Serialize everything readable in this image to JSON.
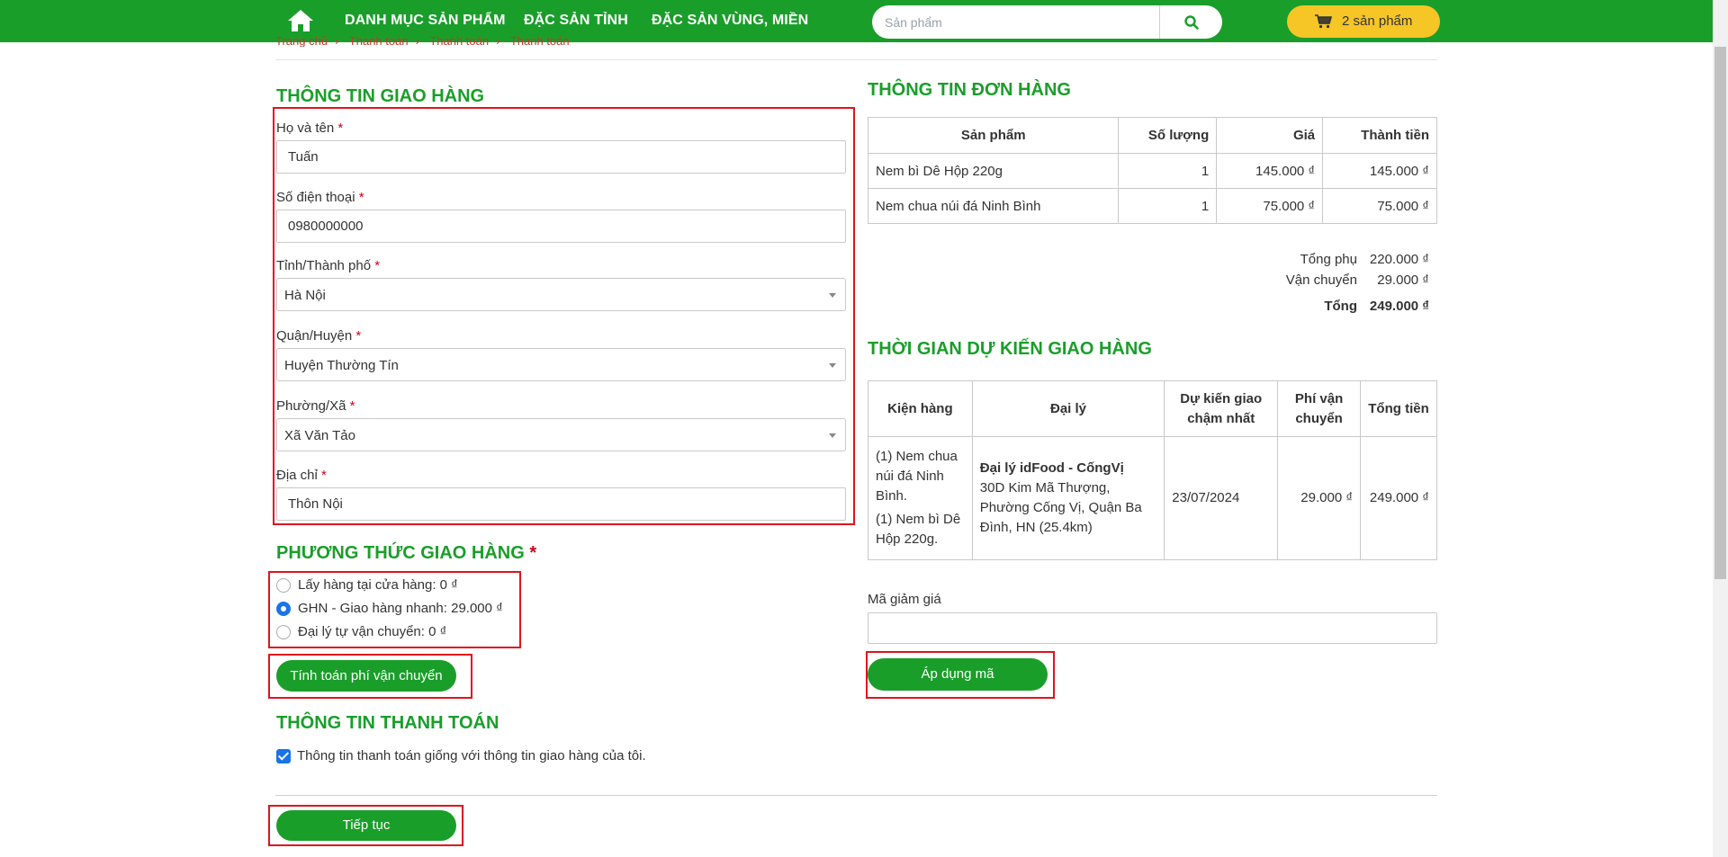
{
  "nav": {
    "links": [
      "DANH MỤC SẢN PHẨM",
      "ĐẶC SẢN TỈNH",
      "ĐẶC SẢN VÙNG, MIỀN"
    ],
    "search_placeholder": "Sản phẩm",
    "cart_label": "2 sản phẩm"
  },
  "breadcrumb": [
    "Trang chủ",
    "Thanh toán",
    "Thanh toán",
    "Thanh toán"
  ],
  "shipping_info": {
    "title": "THÔNG TIN GIAO HÀNG",
    "required_mark": "*",
    "fields": {
      "name": {
        "label": "Họ và tên",
        "value": "Tuấn"
      },
      "phone": {
        "label": "Số điện thoại",
        "value": "0980000000"
      },
      "province": {
        "label": "Tỉnh/Thành phố",
        "value": "Hà Nội"
      },
      "district": {
        "label": "Quận/Huyện",
        "value": "Huyện Thường Tín"
      },
      "ward": {
        "label": "Phường/Xã",
        "value": "Xã Văn Tảo"
      },
      "address": {
        "label": "Địa chỉ",
        "value": "Thôn Nội"
      }
    }
  },
  "shipping_method": {
    "title": "PHƯƠNG THỨC GIAO HÀNG",
    "options": [
      {
        "label": "Lấy hàng tại cửa hàng: 0 ₫",
        "checked": false
      },
      {
        "label": "GHN - Giao hàng nhanh: 29.000 ₫",
        "checked": true
      },
      {
        "label": "Đại lý tự vận chuyển: 0 ₫",
        "checked": false
      }
    ],
    "calc_button": "Tính toán phí vận chuyển"
  },
  "payment_info": {
    "title": "THÔNG TIN THANH TOÁN",
    "same_as_shipping_label": "Thông tin thanh toán giống với thông tin giao hàng của tôi.",
    "same_as_shipping_checked": true
  },
  "continue_button": "Tiếp tục",
  "order_info": {
    "title": "THÔNG TIN ĐƠN HÀNG",
    "headers": [
      "Sản phẩm",
      "Số lượng",
      "Giá",
      "Thành tiền"
    ],
    "rows": [
      [
        "Nem bì Dê Hộp 220g",
        "1",
        "145.000 ₫",
        "145.000 ₫"
      ],
      [
        "Nem chua núi đá Ninh Bình",
        "1",
        "75.000 ₫",
        "75.000 ₫"
      ]
    ],
    "subtotal_label": "Tổng phụ",
    "subtotal_value": "220.000 ₫",
    "shipping_label": "Vận chuyển",
    "shipping_value": "29.000 ₫",
    "total_label": "Tổng",
    "total_value": "249.000 ₫"
  },
  "delivery_time": {
    "title": "THỜI GIAN DỰ KIẾN GIAO HÀNG",
    "headers": [
      "Kiện hàng",
      "Đại lý",
      "Dự kiến giao chậm nhất",
      "Phí vận chuyển",
      "Tổng tiền"
    ],
    "row": {
      "packages": [
        "(1) Nem chua núi đá Ninh Bình.",
        "(1) Nem bì Dê Hộp 220g."
      ],
      "agent_name": "Đại lý idFood - CốngVị",
      "agent_address": "30D Kim Mã Thượng, Phường Cống Vị, Quận Ba Đình, HN (25.4km)",
      "eta": "23/07/2024",
      "fee": "29.000 ₫",
      "total": "249.000 ₫"
    }
  },
  "coupon": {
    "label": "Mã giảm giá",
    "value": "",
    "apply_button": "Áp dụng mã"
  },
  "colors": {
    "brand_green": "#1a9e2a",
    "cart_yellow": "#f6c526",
    "required_red": "#d0021b",
    "highlight_red": "#e0141e",
    "checkbox_blue": "#1a73e8"
  }
}
